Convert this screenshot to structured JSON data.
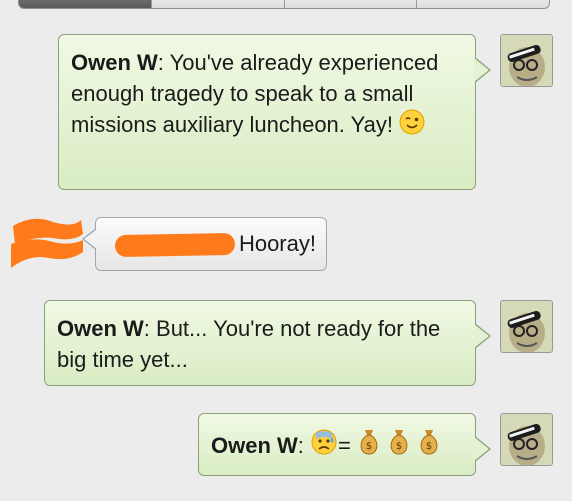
{
  "messages": [
    {
      "sender": "Owen W",
      "separator": ": ",
      "text": "You've already experienced enough tragedy to speak to a small missions auxiliary luncheon. Yay!",
      "emoji": "wink-face-icon"
    },
    {
      "sender": "",
      "text": "Hooray!",
      "redacted_name": true
    },
    {
      "sender": "Owen W",
      "separator": ": ",
      "text": "But... You're not ready for the big time yet..."
    },
    {
      "sender": "Owen W",
      "separator": ": ",
      "equals": "=",
      "emojis": [
        "sad-sweat-face-icon",
        "money-bag-icon",
        "money-bag-icon",
        "money-bag-icon"
      ]
    }
  ],
  "colors": {
    "outgoing_bubble": "#e4f2d3",
    "incoming_bubble": "#f2f2f2",
    "redaction": "#ff7a1a"
  }
}
